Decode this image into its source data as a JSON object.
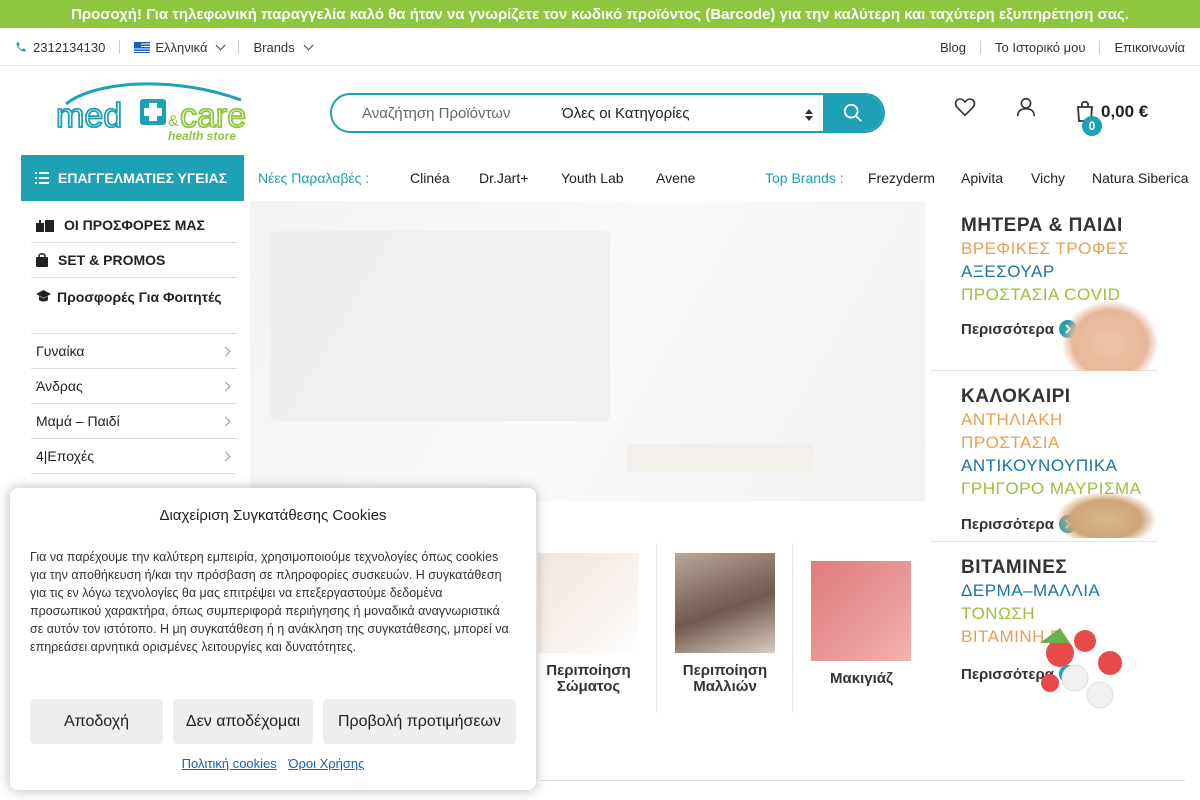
{
  "announcement": "Προσοχή! Για τηλεφωνική παραγγελία καλό θα ήταν να γνωρίζετε τον κωδικό προϊόντος (Barcode) για την καλύτερη και ταχύτερη εξυπηρέτηση σας.",
  "topbar": {
    "phone": "2312134130",
    "language": "Ελληνικά",
    "brands": "Brands",
    "links": [
      "Blog",
      "Το Ιστορικό μου",
      "Επικοινωνία"
    ]
  },
  "logo": {
    "med": "med",
    "amp": "&",
    "care": "care",
    "tagline": "health store"
  },
  "search": {
    "placeholder": "Αναζήτηση Προϊόντων",
    "category": "Όλες οι Κατηγορίες"
  },
  "cart": {
    "count": "0",
    "total": "0,00 €"
  },
  "nav": {
    "pro_button": "ΕΠΑΓΓΕΛΜΑΤΙΕΣ ΥΓΕΙΑΣ",
    "new_label": "Νέες Παραλαβές :",
    "new_items": [
      "Clinéa",
      "Dr.Jart+",
      "Youth Lab",
      "Avene"
    ],
    "top_label": "Top Brands :",
    "top_items": [
      "Frezyderm",
      "Apivita",
      "Vichy",
      "Natura Siberica"
    ]
  },
  "sidemenu": [
    {
      "label": "ΟΙ ΠΡΟΣΦΟΡΕΣ ΜΑΣ",
      "icon": "gifts-icon"
    },
    {
      "label": "SET & PROMOS",
      "icon": "bag-icon"
    },
    {
      "label": "Προσφορές Για Φοιτητές",
      "icon": "graduation-cap-icon"
    },
    {
      "label": "Γυναίκα"
    },
    {
      "label": "Άνδρας"
    },
    {
      "label": "Μαμά – Παιδί"
    },
    {
      "label": "4|Εποχές"
    }
  ],
  "promos": [
    {
      "title": "ΜΗΤΕΡΑ & ΠΑΙΔΙ",
      "lines": [
        "ΒΡΕΦΙΚΕΣ ΤΡΟΦΕΣ",
        "ΑΞΕΣΟΥΑΡ",
        "ΠΡΟΣΤΑΣΙΑ COVID"
      ],
      "more": "Περισσότερα"
    },
    {
      "title": "ΚΑΛΟΚΑΙΡΙ",
      "lines": [
        "ΑΝΤΗΛΙΑΚΗ",
        "ΠΡΟΣΤΑΣΙΑ",
        "ΑΝΤΙΚΟΥΝΟΥΠΙΚΑ",
        "ΓΡΗΓΟΡΟ ΜΑΥΡΙΣΜΑ"
      ],
      "more": "Περισσότερα"
    },
    {
      "title": "ΒΙΤΑΜΙΝΕΣ",
      "lines": [
        "ΔΕΡΜΑ–ΜΑΛΛΙΑ",
        "ΤΟΝΩΣΗ",
        "ΒΙΤΑΜΙΝΗ D"
      ],
      "more": "Περισσότερα"
    }
  ],
  "categories": [
    {
      "line1": "Περιποίηση",
      "line2": "Σώματος"
    },
    {
      "line1": "Περιποίηση",
      "line2": "Μαλλιών"
    },
    {
      "line1": "Μακιγιάζ",
      "line2": ""
    }
  ],
  "cookie": {
    "title": "Διαχείριση Συγκατάθεσης Cookies",
    "body": "Για να παρέχουμε την καλύτερη εμπειρία, χρησιμοποιούμε τεχνολογίες όπως cookies για την αποθήκευση ή/και την πρόσβαση σε πληροφορίες συσκευών. Η συγκατάθεση για τις εν λόγω τεχνολογίες θα μας επιτρέψει να επεξεργαστούμε δεδομένα προσωπικού χαρακτήρα, όπως συμπεριφορά περιήγησης ή μοναδικά αναγνωριστικά σε αυτόν τον ιστότοπο. Η μη συγκατάθεση ή η ανάκληση της συγκατάθεσης, μπορεί να επηρεάσει αρνητικά ορισμένες λειτουργίες και δυνατότητες.",
    "accept": "Αποδοχή",
    "deny": "Δεν αποδέχομαι",
    "prefs": "Προβολή προτιμήσεων",
    "policy_link": "Πολιτική cookies",
    "terms_link": "Όροι Χρήσης"
  },
  "colors": {
    "brand_teal": "#1ea0b5",
    "brand_green": "#8dc63f",
    "accent_orange": "#e8a04c"
  }
}
